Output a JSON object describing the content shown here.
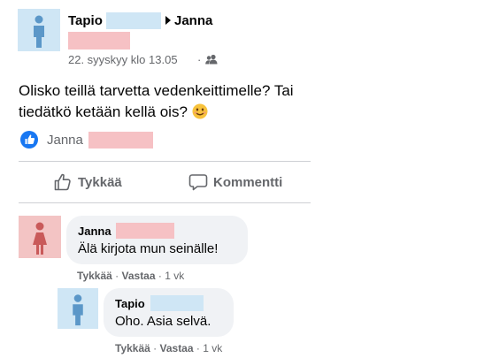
{
  "post": {
    "author": "Tapio",
    "recipient": "Janna",
    "timestamp": "22. syyskyy klo 13.05",
    "separator": "·",
    "audience_icon": "friends-icon",
    "text_line1": "Olisko teillä tarvetta vedenkeittimelle? Tai",
    "text_line2": "tiedätkö ketään kellä ois?",
    "emoji": "😊"
  },
  "reactions": {
    "icon": "like-icon",
    "name": "Janna"
  },
  "actions": {
    "like_label": "Tykkää",
    "comment_label": "Kommentti"
  },
  "comments": [
    {
      "author": "Janna",
      "text": "Älä kirjota mun seinälle!",
      "like": "Tykkää",
      "reply": "Vastaa",
      "time": "1 vk",
      "sep": "·"
    },
    {
      "author": "Tapio",
      "text": "Oho. Asia selvä.",
      "like": "Tykkää",
      "reply": "Vastaa",
      "time": "1 vk",
      "sep": "·"
    }
  ],
  "colors": {
    "like_blue": "#1877f2",
    "muted": "#65676b",
    "bubble": "#f0f2f5",
    "male_avatar": "#cfe6f5",
    "female_avatar": "#f3c4c4"
  }
}
